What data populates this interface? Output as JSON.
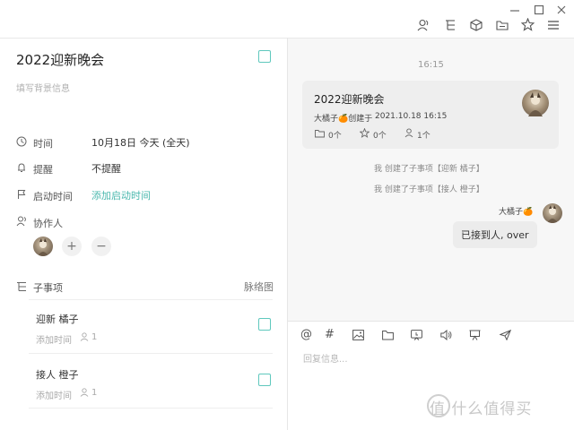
{
  "window": {
    "controls": [
      "minimize-icon",
      "maximize-icon",
      "close-icon"
    ],
    "toolbar": [
      "members-icon",
      "subtask-tree-icon",
      "box-icon",
      "folder-icon",
      "star-icon",
      "menu-icon"
    ]
  },
  "task": {
    "title": "2022迎新晚会",
    "background_placeholder": "填写背景信息",
    "time_label": "时间",
    "time_value": "10月18日 今天 (全天)",
    "reminder_label": "提醒",
    "reminder_value": "不提醒",
    "start_label": "启动时间",
    "start_value": "添加启动时间",
    "collaborators_label": "协作人",
    "add_symbol": "+",
    "remove_symbol": "−",
    "subtasks_label": "子事项",
    "mindmap_label": "脉络图",
    "subtasks": [
      {
        "title": "迎新 橘子",
        "add_time": "添加时间",
        "count": "1"
      },
      {
        "title": "接人 橙子",
        "add_time": "添加时间",
        "count": "1"
      }
    ]
  },
  "chat": {
    "timestamp": "16:15",
    "card": {
      "title": "2022迎新晚会",
      "creator": "大橘子🍊创建于",
      "created": "2021.10.18 16:15",
      "stats": [
        "0个",
        "0个",
        "1个"
      ]
    },
    "system": [
      "我 创建了子事项【迎新 橘子】",
      "我 创建了子事项【接人 橙子】"
    ],
    "sender": "大橘子🍊",
    "message": "已接到人, over",
    "reply_placeholder": "回复信息..."
  },
  "watermark": "值 什么值得买",
  "colors": {
    "accent": "#5fc8bd",
    "link": "#4ab8ae",
    "divider": "#e6e6e6"
  }
}
